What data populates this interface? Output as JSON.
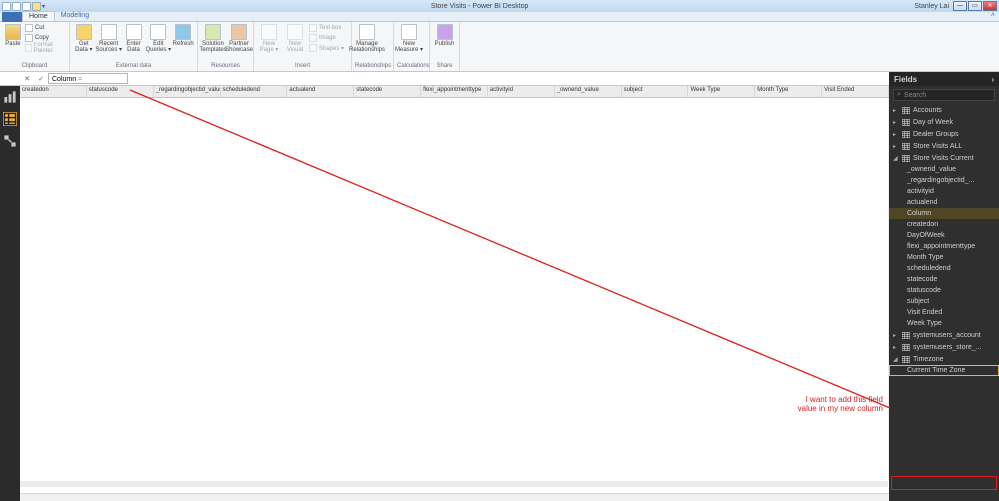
{
  "window": {
    "title": "Store Visits - Power BI Desktop",
    "user": "Stanley Lai"
  },
  "tabs": {
    "file": "",
    "home": "Home",
    "modeling": "Modeling"
  },
  "ribbon": {
    "clipboard": {
      "paste": "Paste",
      "cut": "Cut",
      "copy": "Copy",
      "fp": "Format Painter",
      "label": "Clipboard"
    },
    "external": {
      "getdata": "Get\nData ▾",
      "recent": "Recent\nSources ▾",
      "enter": "Enter\nData",
      "edit": "Edit\nQueries ▾",
      "refresh": "Refresh",
      "label": "External data"
    },
    "resources": {
      "sol": "Solution\nTemplates",
      "part": "Partner\nShowcase",
      "label": "Resources"
    },
    "insert": {
      "page": "New\nPage ▾",
      "visual": "New\nVisual",
      "textbox": "Text box",
      "image": "Image",
      "shapes": "Shapes ▾",
      "label": "Insert"
    },
    "rel": {
      "mng": "Manage\nRelationships",
      "label": "Relationships"
    },
    "calc": {
      "measure": "New\nMeasure ▾",
      "label": "Calculations"
    },
    "share": {
      "publish": "Publish",
      "label": "Share"
    }
  },
  "formula": {
    "name": "Column",
    "dd": "="
  },
  "columns": [
    "createdon",
    "statuscode",
    "_regardingobjectid_value",
    "scheduledend",
    "actualend",
    "statecode",
    "flexi_appointmenttype",
    "activityid",
    "_ownerid_value",
    "subject",
    "Week Type",
    "Month Type",
    "Visit Ended"
  ],
  "fields": {
    "title": "Fields",
    "search_placeholder": "Search",
    "tables": [
      {
        "name": "Accounts",
        "expanded": false
      },
      {
        "name": "Day of Week",
        "expanded": false
      },
      {
        "name": "Dealer Groups",
        "expanded": false
      },
      {
        "name": "Store Visits ALL",
        "expanded": false
      },
      {
        "name": "Store Visits Current",
        "expanded": true,
        "cols": [
          "_ownerid_value",
          "_regardingobjectid_...",
          "activityid",
          "actualend",
          "Column",
          "createdon",
          "DayOfWeek",
          "flexi_appointmenttype",
          "Month Type",
          "scheduledend",
          "statecode",
          "statuscode",
          "subject",
          "Visit Ended",
          "Week Type"
        ]
      },
      {
        "name": "systemusers_account",
        "expanded": false
      },
      {
        "name": "systemusers_store_...",
        "expanded": false
      },
      {
        "name": "Timezone",
        "expanded": true,
        "cols": [
          "Current Time Zone"
        ]
      }
    ]
  },
  "annotation": {
    "line1": "I want to add this field",
    "line2": "value in my new column"
  }
}
